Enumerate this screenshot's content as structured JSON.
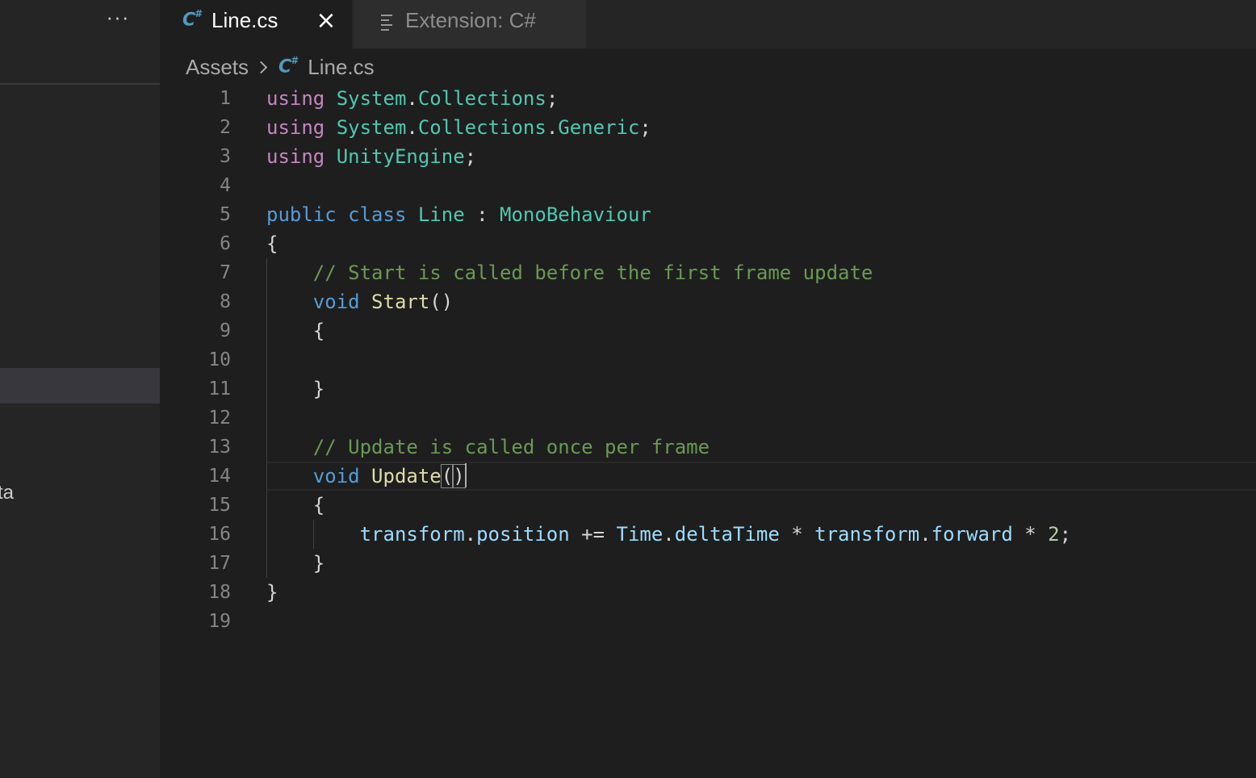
{
  "sidebar": {
    "more_label": "···",
    "partial_label": "ta"
  },
  "tabs": [
    {
      "icon": "csharp-icon",
      "label": "Line.cs",
      "active": true,
      "close": "×"
    },
    {
      "icon": "preview-doc-icon",
      "label": "Extension: C#",
      "active": false
    }
  ],
  "breadcrumb": {
    "folder": "Assets",
    "file": "Line.cs"
  },
  "editor": {
    "line_numbers": [
      "1",
      "2",
      "3",
      "4",
      "5",
      "6",
      "7",
      "8",
      "9",
      "10",
      "11",
      "12",
      "13",
      "14",
      "15",
      "16",
      "17",
      "18",
      "19"
    ],
    "code": {
      "l1": [
        "using",
        "System",
        ".",
        "Collections",
        ";"
      ],
      "l2": [
        "using",
        "System",
        ".",
        "Collections",
        ".",
        "Generic",
        ";"
      ],
      "l3": [
        "using",
        "UnityEngine",
        ";"
      ],
      "l5": [
        "public",
        "class",
        "Line",
        ":",
        "MonoBehaviour"
      ],
      "l6": "{",
      "l7": "// Start is called before the first frame update",
      "l8": [
        "void",
        "Start",
        "()"
      ],
      "l9": "{",
      "l11": "}",
      "l13": "// Update is called once per frame",
      "l14": [
        "void",
        "Update",
        "(",
        ")"
      ],
      "l15": "{",
      "l16": [
        "transform",
        ".",
        "position",
        "+=",
        "Time",
        ".",
        "deltaTime",
        "*",
        "transform",
        ".",
        "forward",
        "*",
        "2",
        ";"
      ],
      "l17": "}",
      "l18": "}"
    }
  },
  "colors": {
    "keyword_control": "#c586c0",
    "keyword": "#569cd6",
    "type": "#4ec9b0",
    "function": "#dcdcaa",
    "variable": "#9cdcfe",
    "number": "#b5cea8",
    "comment": "#6a9955",
    "csharp_icon": "#519aba"
  }
}
